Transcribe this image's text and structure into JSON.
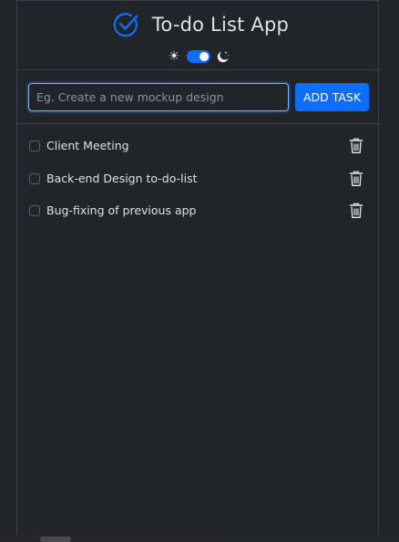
{
  "app": {
    "title": "To-do List App"
  },
  "theme_toggle": {
    "light_icon": "sun-icon",
    "dark_icon": "moon-icon",
    "dark_mode_enabled": true
  },
  "task_form": {
    "placeholder": "Eg. Create a new mockup design",
    "value": "",
    "add_button_label": "ADD TASK"
  },
  "tasks": [
    {
      "label": "Client Meeting",
      "done": false
    },
    {
      "label": "Back-end Design to-do-list",
      "done": false
    },
    {
      "label": "Bug-fixing of previous app",
      "done": false
    }
  ],
  "colors": {
    "background": "#212529",
    "accent": "#0d6efd",
    "text": "#dee2e6",
    "border": "#3c4046"
  }
}
